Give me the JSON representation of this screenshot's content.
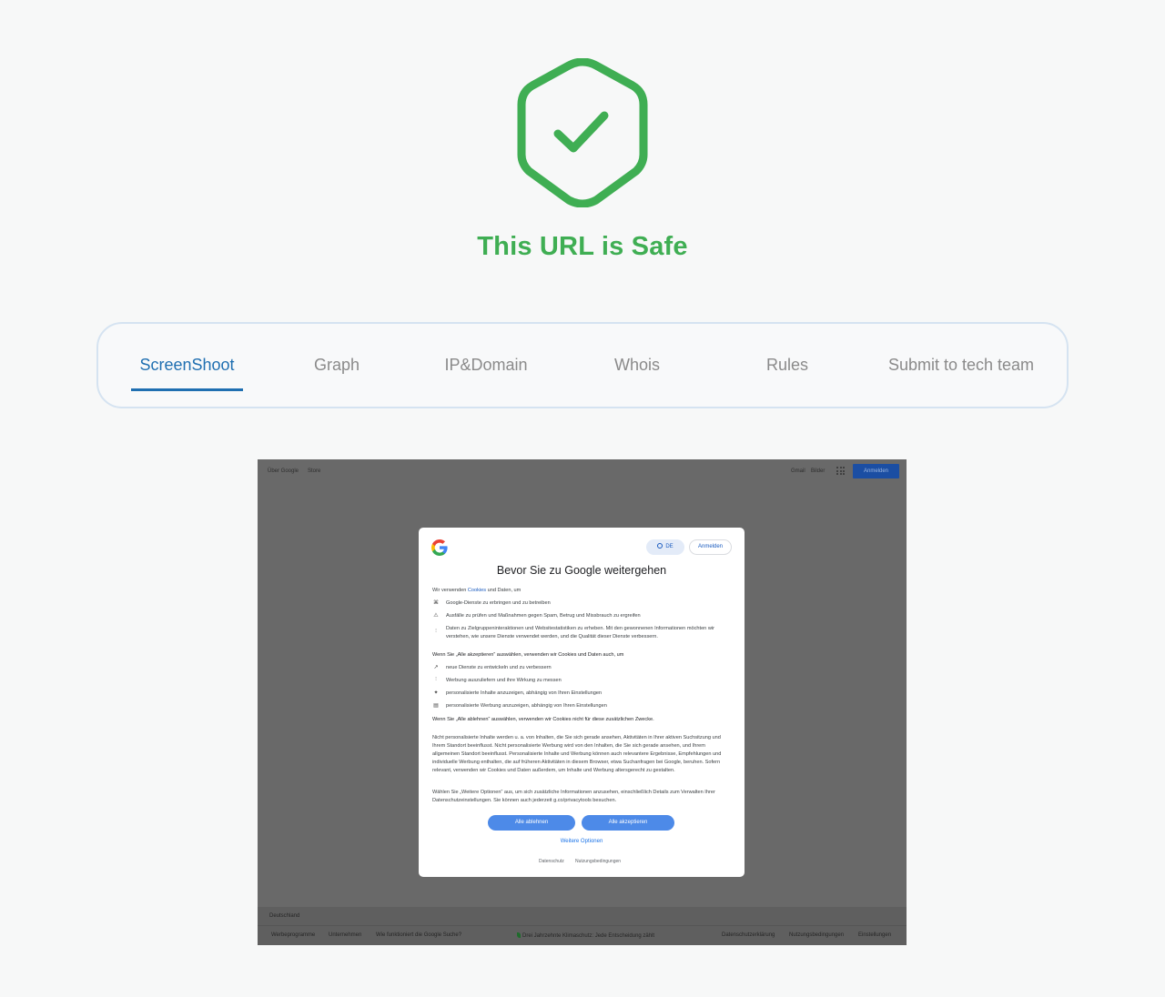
{
  "status": {
    "title": "This URL is Safe",
    "icon": "shield-check-icon",
    "color": "#3fae53"
  },
  "tabs": [
    {
      "label": "ScreenShoot",
      "active": true
    },
    {
      "label": "Graph",
      "active": false
    },
    {
      "label": "IP&Domain",
      "active": false
    },
    {
      "label": "Whois",
      "active": false
    },
    {
      "label": "Rules",
      "active": false
    },
    {
      "label": "Submit to tech team",
      "active": false
    }
  ],
  "screenshot": {
    "topbar": {
      "left": [
        "Über Google",
        "Store"
      ],
      "right": [
        "Gmail",
        "Bilder"
      ],
      "signin": "Anmelden"
    },
    "dialog": {
      "lang": "DE",
      "signin": "Anmelden",
      "title": "Bevor Sie zu Google weitergehen",
      "intro_pre": "Wir verwenden ",
      "intro_link": "Cookies",
      "intro_post": " und Daten, um",
      "purposes": [
        {
          "icon": "⌘",
          "text": "Google-Dienste zu erbringen und zu betreiben"
        },
        {
          "icon": "⚠",
          "text": "Ausfälle zu prüfen und Maßnahmen gegen Spam, Betrug und Missbrauch zu ergreifen"
        },
        {
          "icon": "⫶",
          "text": "Daten zu Zielgruppeninteraktionen und Websitestatistiken zu erheben. Mit den gewonnenen Informationen möchten wir verstehen, wie unsere Dienste verwendet werden, und die Qualität dieser Dienste verbessern."
        }
      ],
      "accept_heading": "Wenn Sie „Alle akzeptieren“ auswählen, verwenden wir Cookies und Daten auch, um",
      "accept_purposes": [
        {
          "icon": "↗",
          "text": "neue Dienste zu entwickeln und zu verbessern"
        },
        {
          "icon": "⫶",
          "text": "Werbung auszuliefern und ihre Wirkung zu messen"
        },
        {
          "icon": "✦",
          "text": "personalisierte Inhalte anzuzeigen, abhängig von Ihren Einstellungen"
        },
        {
          "icon": "▤",
          "text": "personalisierte Werbung anzuzeigen, abhängig von Ihren Einstellungen"
        }
      ],
      "reject_heading": "Wenn Sie „Alle ablehnen“ auswählen, verwenden wir Cookies nicht für diese zusätzlichen Zwecke.",
      "para1": "Nicht personalisierte Inhalte werden u. a. von Inhalten, die Sie sich gerade ansehen, Aktivitäten in Ihrer aktiven Suchsitzung und Ihrem Standort beeinflusst. Nicht personalisierte Werbung wird von den Inhalten, die Sie sich gerade ansehen, und Ihrem allgemeinen Standort beeinflusst. Personalisierte Inhalte und Werbung können auch relevantere Ergebnisse, Empfehlungen und individuelle Werbung enthalten, die auf früheren Aktivitäten in diesem Browser, etwa Suchanfragen bei Google, beruhen. Sofern relevant, verwenden wir Cookies und Daten außerdem, um Inhalte und Werbung altersgerecht zu gestalten.",
      "para2": "Wählen Sie „Weitere Optionen“ aus, um sich zusätzliche Informationen anzusehen, einschließlich Details zum Verwalten Ihrer Datenschutzeinstellungen. Sie können auch jederzeit g.co/privacytools besuchen.",
      "reject_button": "Alle ablehnen",
      "accept_button": "Alle akzeptieren",
      "more_options": "Weitere Optionen",
      "footer_links": [
        "Datenschutz",
        "Nutzungsbedingungen"
      ]
    },
    "footer": {
      "country": "Deutschland",
      "links_left": [
        "Werbeprogramme",
        "Unternehmen",
        "Wie funktioniert die Google Suche?"
      ],
      "center": "Drei Jahrzehnte Klimaschutz: Jede Entscheidung zählt",
      "links_right": [
        "Datenschutzerklärung",
        "Nutzungsbedingungen",
        "Einstellungen"
      ]
    }
  }
}
